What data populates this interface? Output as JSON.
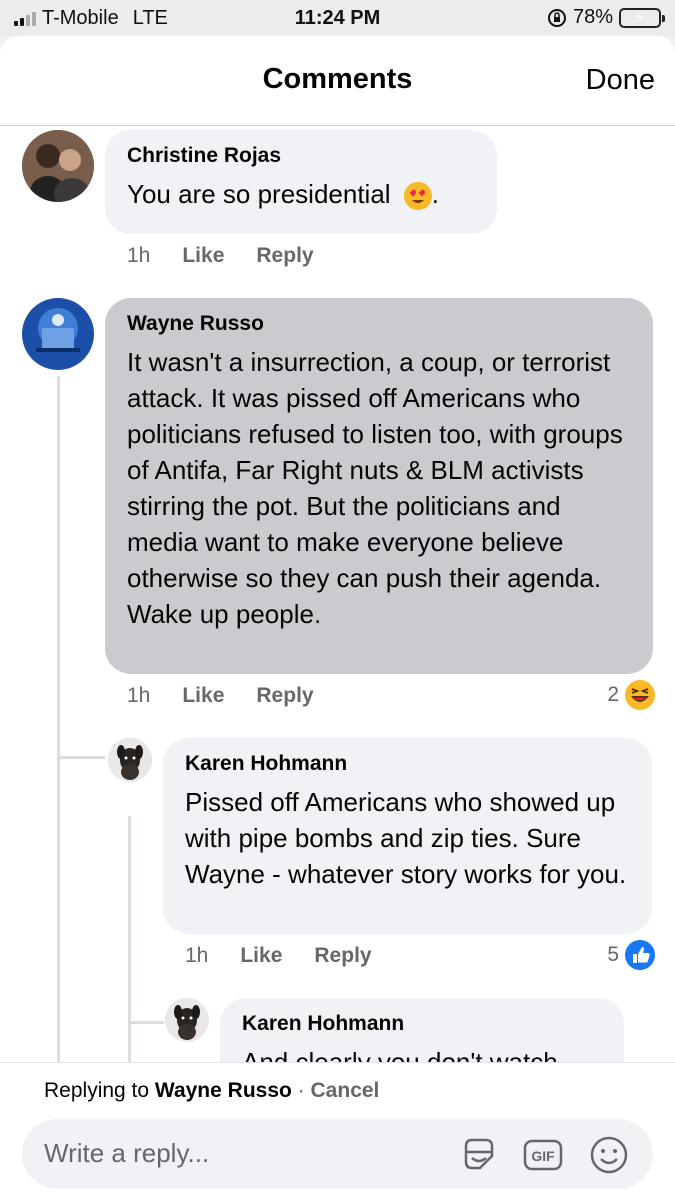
{
  "status_bar": {
    "carrier": "T-Mobile",
    "network": "LTE",
    "time": "11:24 PM",
    "battery": "78%",
    "battery_level": 0.78
  },
  "header": {
    "title": "Comments",
    "done_label": "Done"
  },
  "comments": [
    {
      "author": "Christine Rojas",
      "text": "You are so presidential",
      "text_suffix": ".",
      "emoji": "heart-eyes-emoji",
      "time": "1h",
      "like_label": "Like",
      "reply_label": "Reply"
    },
    {
      "author": "Wayne Russo",
      "text": "It wasn't a insurrection, a coup, or terrorist attack. It was pissed off Americans who politicians refused to listen too, with groups of Antifa, Far Right nuts & BLM activists stirring the pot. But the politicians and media want to make everyone believe otherwise so they can push their agenda. Wake up people.",
      "time": "1h",
      "like_label": "Like",
      "reply_label": "Reply",
      "reaction_count": "2",
      "reaction_icon": "laughing-emoji"
    },
    {
      "author": "Karen Hohmann",
      "text": "Pissed off Americans who showed up with pipe bombs and zip ties. Sure Wayne - whatever story works for you.",
      "time": "1h",
      "like_label": "Like",
      "reply_label": "Reply",
      "reaction_count": "5",
      "reaction_icon": "thumbs-up-icon"
    },
    {
      "author": "Karen Hohmann",
      "text": "And clearly you don't watch"
    }
  ],
  "reply_bar": {
    "replying_prefix": "Replying to",
    "replying_to": "Wayne Russo",
    "separator": "·",
    "cancel_label": "Cancel",
    "placeholder": "Write a reply..."
  },
  "colors": {
    "bubble": "#f0f2f5",
    "bubble_selected": "#c9cbcf",
    "like_blue": "#1877f2",
    "battery_green": "#4cd964"
  }
}
